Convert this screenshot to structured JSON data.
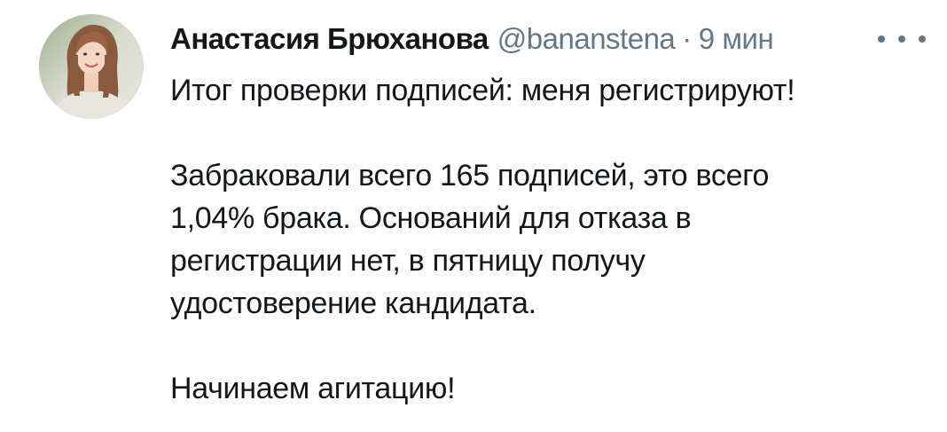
{
  "author": {
    "display_name": "Анастасия Брюханова",
    "handle": "@bananstena",
    "separator": "·",
    "timestamp": "9 мин"
  },
  "tweet": {
    "paragraphs": [
      [
        "Итог проверки подписей: меня регистрируют!"
      ],
      [
        "Забраковали всего 165 подписей, это всего",
        "1,04% брака. Оснований для отказа в",
        "регистрации нет, в пятницу получу",
        "удостоверение кандидата."
      ],
      [
        "Начинаем агитацию!"
      ]
    ]
  },
  "icons": {
    "avatar": "profile-photo",
    "more": "more-horizontal-icon"
  },
  "colors": {
    "text": "#14171a",
    "secondary": "#657786",
    "background": "#ffffff"
  }
}
